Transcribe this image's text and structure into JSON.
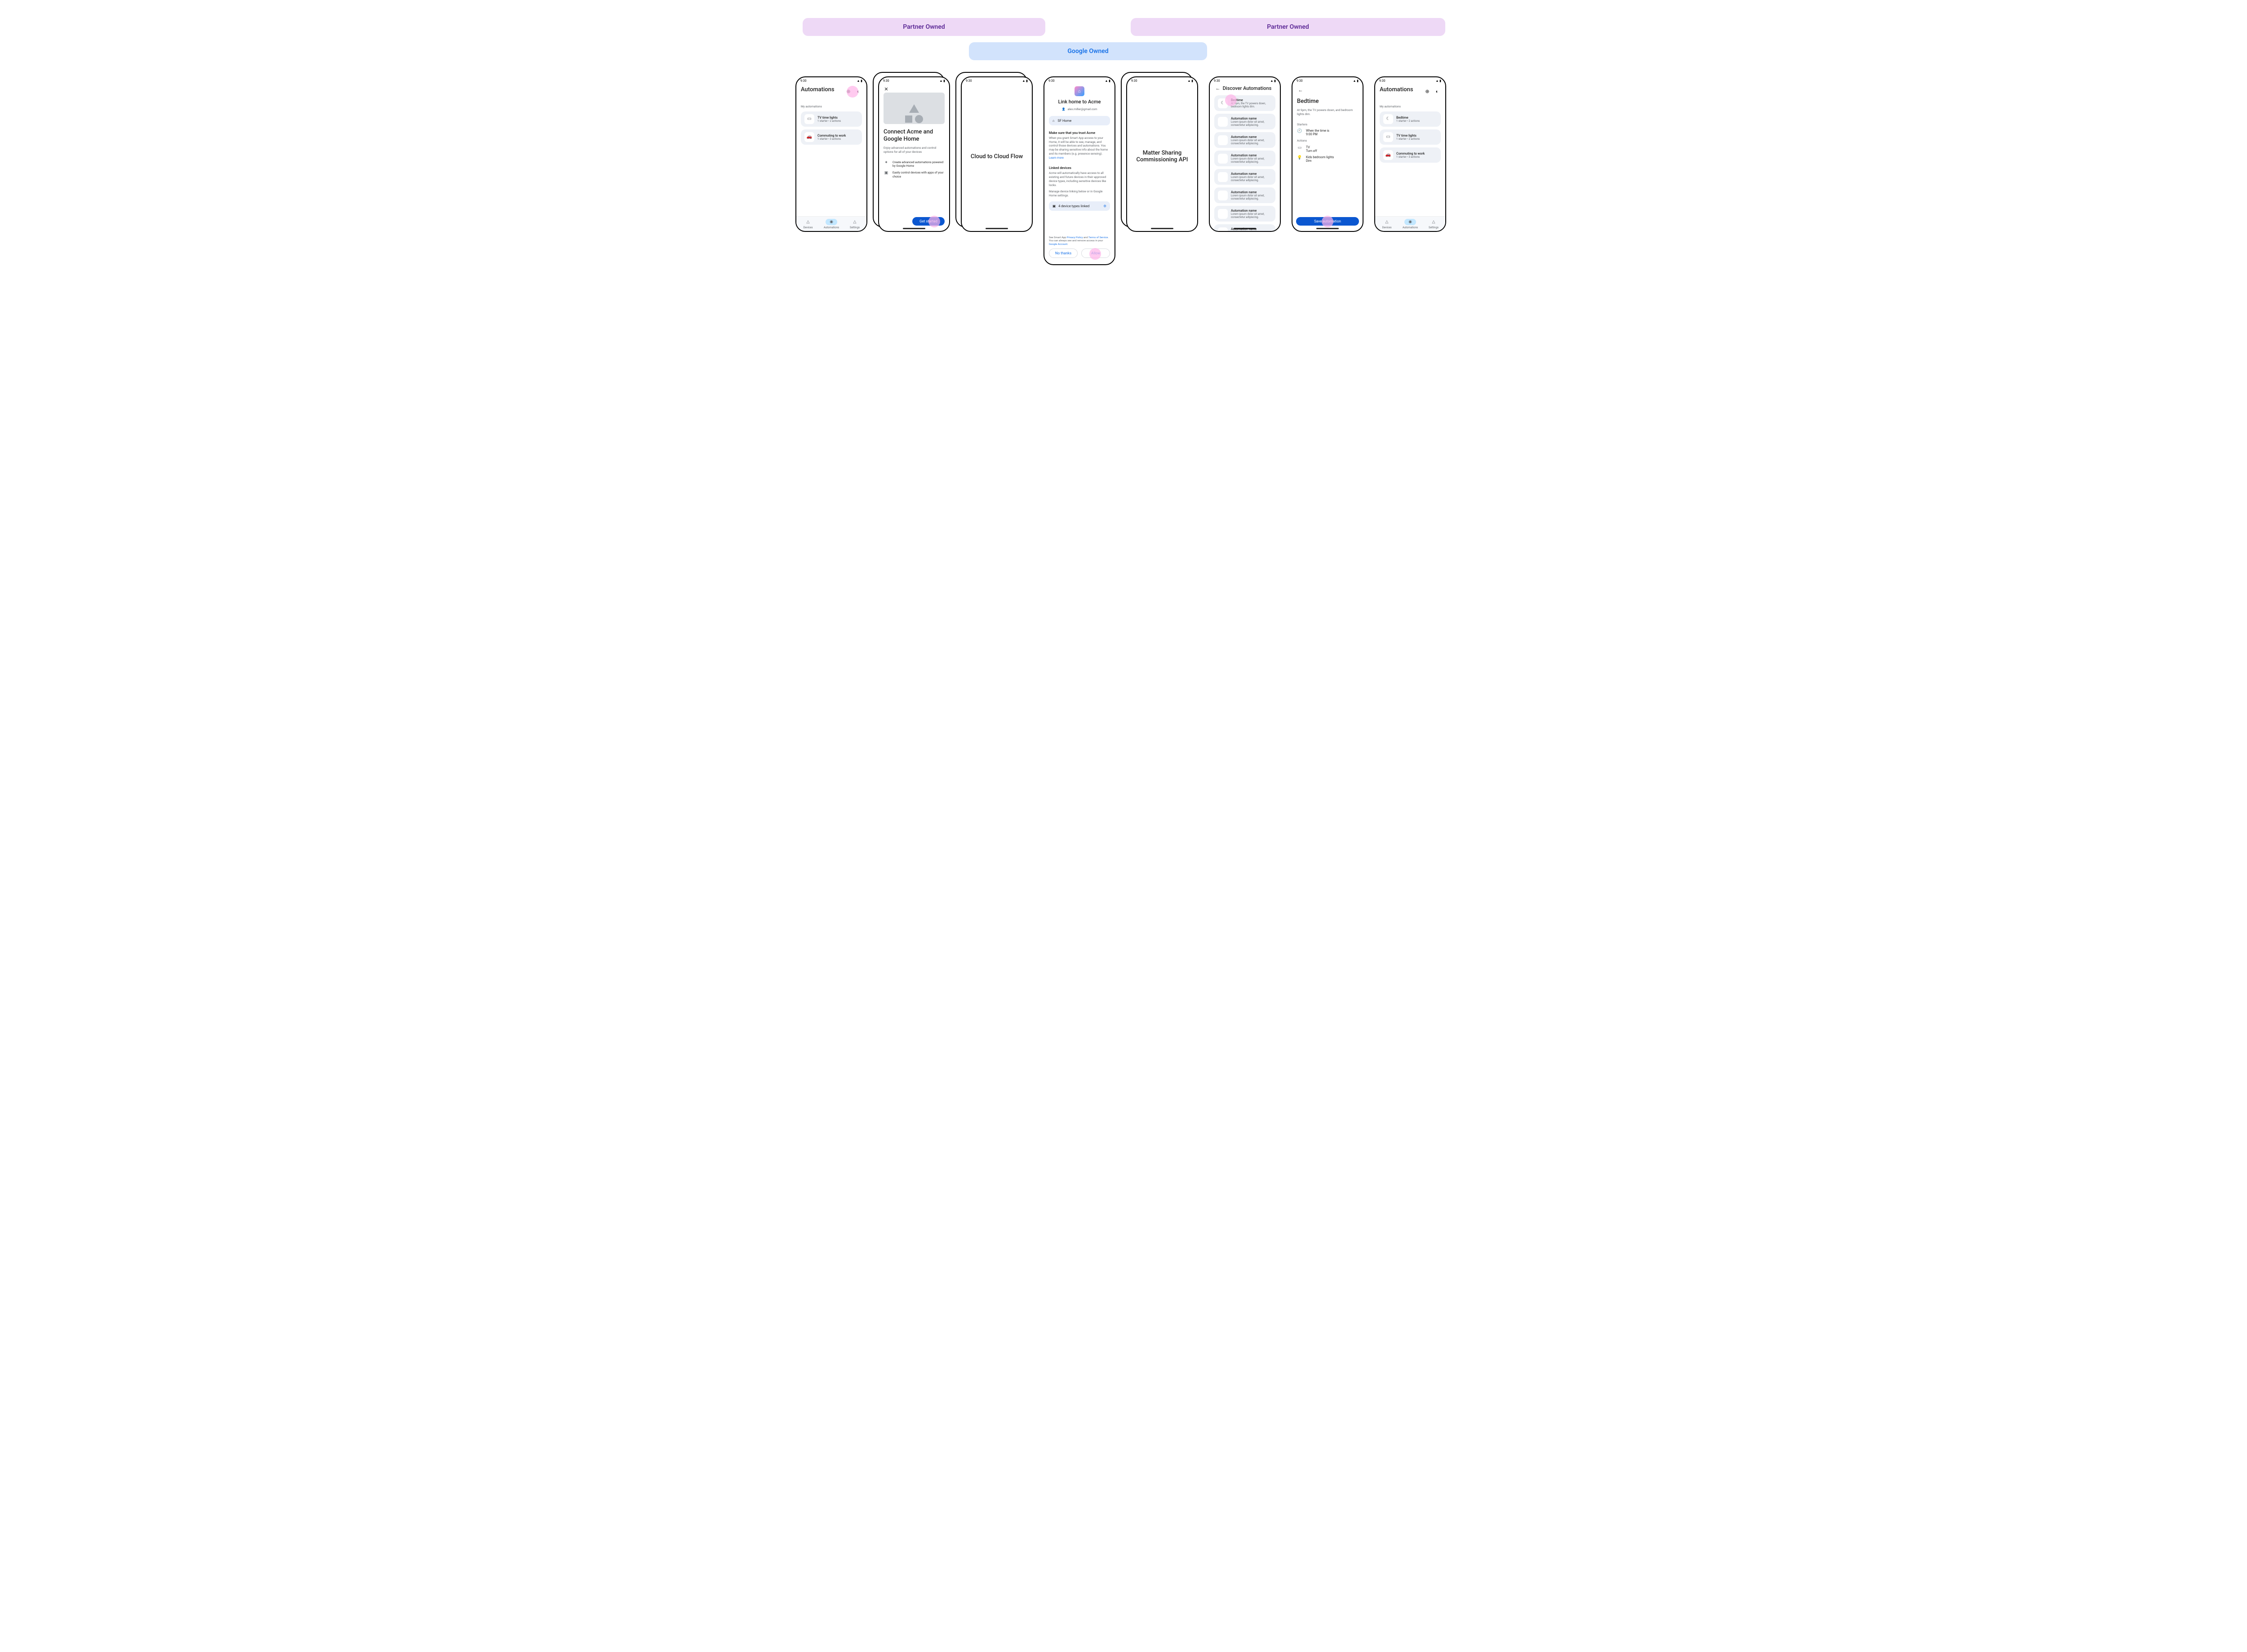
{
  "banners": {
    "partner1": "Partner Owned",
    "partner2": "Partner Owned",
    "google": "Google Owned"
  },
  "statusbar": {
    "time": "9:30"
  },
  "nav": {
    "devices": "Devices",
    "automations": "Automations",
    "settings": "Settings"
  },
  "screen1": {
    "title": "Automations",
    "section": "My automations",
    "items": [
      {
        "icon": "tv",
        "title": "TV time lights",
        "sub": "1 starter • 2 actions"
      },
      {
        "icon": "car",
        "title": "Commuting to work",
        "sub": "1 starter • 3 actions"
      }
    ]
  },
  "screen2": {
    "title": "Connect Acme and Google Home",
    "subtitle": "Enjoy advanced automations and control options for all of your devices",
    "bullets": [
      {
        "icon": "✦",
        "text": "Create advanced automations powered by Google Home"
      },
      {
        "icon": "▣",
        "text": "Easily control devices with apps of your choice"
      }
    ],
    "cta": "Get started"
  },
  "screen3": {
    "title": "Cloud to Cloud Flow"
  },
  "screen4": {
    "title": "Link home to Acme",
    "email": "alex.miller@gmail.com",
    "home_chip": "SF Home",
    "trust_heading": "Make sure that you trust Acme",
    "trust_body_a": "When you grant Smart App access to your Home, it will be able to  see, manage, and control those devices and automations. You may be sharing sensitive info about the home and its members (e.g. presence sensing). ",
    "learn_more": "Learn more",
    "linked_heading": "Linked devices",
    "linked_body": "Acme will automatically have access to all existing and future devices in their approved device types, including sensitive devices like locks.",
    "linked_manage": "Manage device linking below or in Google Home settings.",
    "linked_chip": "4 device types linked",
    "footer_a": "See Smart App ",
    "footer_pp": "Privacy Policy",
    "footer_and": " and ",
    "footer_tos": "Terms of Service",
    "footer_b": ". You can always see and remove access in your ",
    "footer_ga": "Google Account",
    "no": "No thanks",
    "allow": "Allow"
  },
  "screen5": {
    "title": "Matter Sharing Commissioning API"
  },
  "screen6": {
    "title": "Discover Automations",
    "featured": {
      "title": "Bedtime",
      "sub": "At 9pm, the TV powers down, bedroom lights dim."
    },
    "items": [
      {
        "title": "Automation name",
        "sub": "Lorem ipsum dolor sit amet, consectetur adipiscing."
      },
      {
        "title": "Automation name",
        "sub": "Lorem ipsum dolor sit amet, consectetur adipiscing."
      },
      {
        "title": "Automation name",
        "sub": "Lorem ipsum dolor sit amet, consectetur adipiscing."
      },
      {
        "title": "Automation name",
        "sub": "Lorem ipsum dolor sit amet, consectetur adipiscing."
      },
      {
        "title": "Automation name",
        "sub": "Lorem ipsum dolor sit amet, consectetur adipiscing."
      },
      {
        "title": "Automation name",
        "sub": "Lorem ipsum dolor sit amet, consectetur adipiscing."
      },
      {
        "title": "Automation name",
        "sub": "Lorem ipsum dolor sit amet, consectetur adipiscing."
      }
    ]
  },
  "screen7": {
    "title": "Bedtime",
    "sub": "At 9pm, the TV powers down, and bedroom lights dim.",
    "starters_h": "Starters",
    "starter": {
      "l1": "When the time is",
      "l2": "9:00 PM"
    },
    "actions_h": "Actions",
    "actions": [
      {
        "icon": "tv",
        "l1": "TV",
        "l2": "Turn off"
      },
      {
        "icon": "bulb",
        "l1": "Kids bedroom lights",
        "l2": "Dim"
      }
    ],
    "cta": "Save automation"
  },
  "screen8": {
    "title": "Automations",
    "section": "My automations",
    "items": [
      {
        "icon": "moon",
        "title": "Bedtime",
        "sub": "1 starter • 2 actions"
      },
      {
        "icon": "tv",
        "title": "TV time lights",
        "sub": "1 starter • 2 actions"
      },
      {
        "icon": "car",
        "title": "Commuting to work",
        "sub": "1 starter • 3 actions"
      }
    ]
  }
}
